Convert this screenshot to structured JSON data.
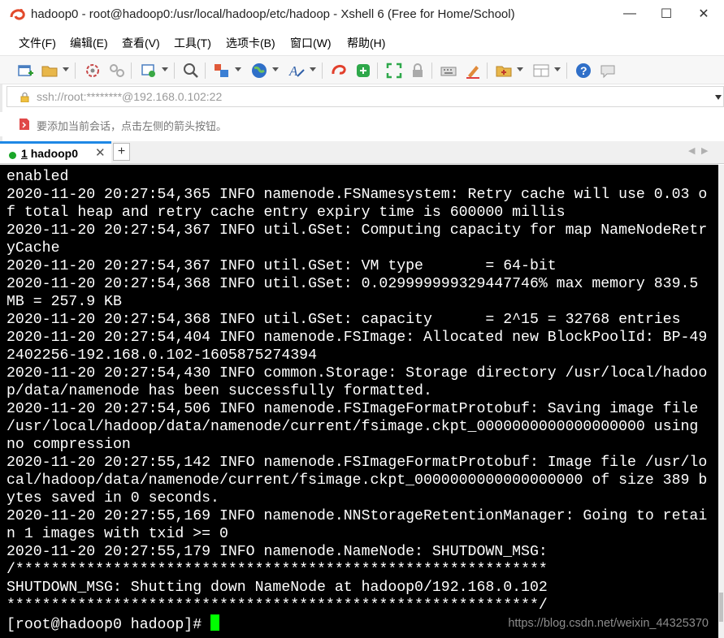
{
  "window": {
    "title": "hadoop0 - root@hadoop0:/usr/local/hadoop/etc/hadoop - Xshell 6 (Free for Home/School)",
    "controls": {
      "minimize": "—",
      "maximize": "☐",
      "close": "✕"
    }
  },
  "menu": {
    "items": [
      "文件(F)",
      "编辑(E)",
      "查看(V)",
      "工具(T)",
      "选项卡(B)",
      "窗口(W)",
      "帮助(H)"
    ]
  },
  "toolbar": {
    "icons": [
      "new-session-icon",
      "open-folder-icon",
      "reconnect-icon",
      "disconnect-icon",
      "properties-icon",
      "search-icon",
      "transfer-icon",
      "globe-icon",
      "font-icon",
      "xftp-icon",
      "xshell-icon",
      "fullscreen-icon",
      "lock-icon",
      "keyboard-icon",
      "highlight-icon",
      "compose-icon",
      "layout-icon",
      "help-icon",
      "chat-icon"
    ]
  },
  "address": {
    "value": "ssh://root:********@192.168.0.102:22"
  },
  "hint": {
    "text": "要添加当前会话，点击左侧的箭头按钮。"
  },
  "tabs": [
    {
      "number": "1",
      "label": "hadoop0",
      "close": "✕",
      "status_color": "#1aa628"
    }
  ],
  "tab_new_label": "+",
  "tab_nav": {
    "prev": "◀",
    "next": "▶"
  },
  "terminal": {
    "lines": [
      "enabled",
      "2020-11-20 20:27:54,365 INFO namenode.FSNamesystem: Retry cache will use 0.03 o",
      "f total heap and retry cache entry expiry time is 600000 millis",
      "2020-11-20 20:27:54,367 INFO util.GSet: Computing capacity for map NameNodeRetr",
      "yCache",
      "2020-11-20 20:27:54,367 INFO util.GSet: VM type       = 64-bit",
      "2020-11-20 20:27:54,368 INFO util.GSet: 0.029999999329447746% max memory 839.5",
      "MB = 257.9 KB",
      "2020-11-20 20:27:54,368 INFO util.GSet: capacity      = 2^15 = 32768 entries",
      "2020-11-20 20:27:54,404 INFO namenode.FSImage: Allocated new BlockPoolId: BP-49",
      "2402256-192.168.0.102-1605875274394",
      "2020-11-20 20:27:54,430 INFO common.Storage: Storage directory /usr/local/hadoo",
      "p/data/namenode has been successfully formatted.",
      "2020-11-20 20:27:54,506 INFO namenode.FSImageFormatProtobuf: Saving image file",
      "/usr/local/hadoop/data/namenode/current/fsimage.ckpt_0000000000000000000 using",
      "no compression",
      "2020-11-20 20:27:55,142 INFO namenode.FSImageFormatProtobuf: Image file /usr/lo",
      "cal/hadoop/data/namenode/current/fsimage.ckpt_0000000000000000000 of size 389 b",
      "ytes saved in 0 seconds.",
      "2020-11-20 20:27:55,169 INFO namenode.NNStorageRetentionManager: Going to retai",
      "n 1 images with txid >= 0",
      "2020-11-20 20:27:55,179 INFO namenode.NameNode: SHUTDOWN_MSG:",
      "/************************************************************",
      "SHUTDOWN_MSG: Shutting down NameNode at hadoop0/192.168.0.102",
      "************************************************************/"
    ],
    "prompt": "[root@hadoop0 hadoop]# ",
    "cursor_color": "#00ff00",
    "background": "#000000",
    "foreground": "#ffffff"
  },
  "watermark": "https://blog.csdn.net/weixin_44325370",
  "colors": {
    "tab_accent": "#1e88e5",
    "status_green": "#1aa628"
  }
}
